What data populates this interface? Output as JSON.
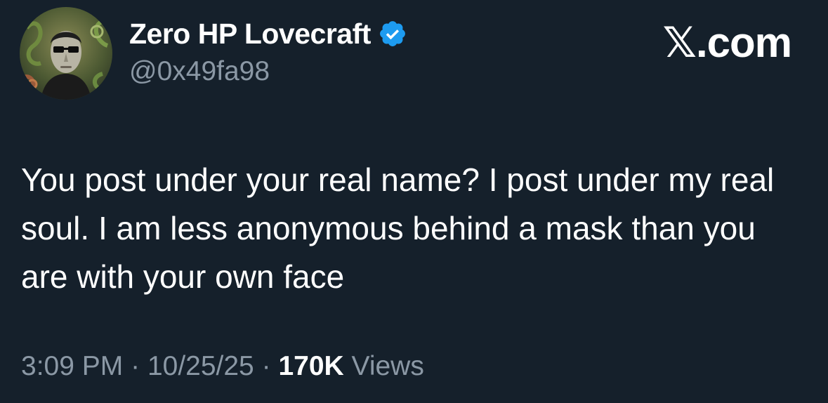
{
  "author": {
    "display_name": "Zero HP Lovecraft",
    "handle": "@0x49fa98",
    "verified": true,
    "avatar_icon": "avatar-portrait-icon",
    "badge_icon": "verified-badge-icon"
  },
  "site": {
    "label": "𝕏.com"
  },
  "tweet": {
    "text": "You post under your real name? I post under my real soul. I am less anonymous behind a mask than you are with your own face"
  },
  "meta": {
    "time": "3:09 PM",
    "separator": "·",
    "date": "10/25/25",
    "views_count": "170K",
    "views_label": "Views"
  },
  "colors": {
    "background": "#15202b",
    "text": "#ffffff",
    "secondary_text": "#8b98a5",
    "verified_blue": "#1d9bf0"
  }
}
